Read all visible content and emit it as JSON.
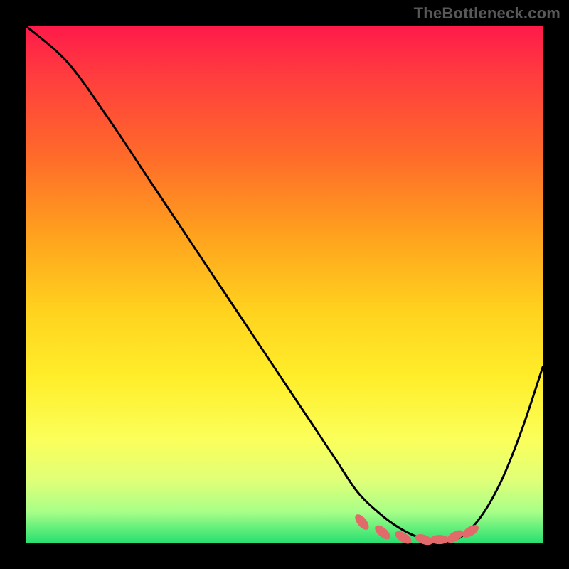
{
  "watermark": "TheBottleneck.com",
  "chart_data": {
    "type": "line",
    "title": "",
    "xlabel": "",
    "ylabel": "",
    "xlim": [
      0,
      100
    ],
    "ylim": [
      0,
      100
    ],
    "grid": false,
    "legend": false,
    "series": [
      {
        "name": "bottleneck-curve",
        "color": "#000000",
        "x": [
          0,
          8,
          16,
          24,
          32,
          40,
          48,
          56,
          60,
          64,
          68,
          72,
          76,
          80,
          84,
          88,
          92,
          96,
          100
        ],
        "y": [
          100,
          93,
          82,
          70,
          58,
          46,
          34,
          22,
          16,
          10,
          6,
          3,
          1,
          0,
          1,
          5,
          12,
          22,
          34
        ]
      }
    ],
    "markers": {
      "name": "highlight-dots",
      "color": "#e36a6a",
      "points": [
        {
          "x": 65,
          "y": 4.0
        },
        {
          "x": 69,
          "y": 2.0
        },
        {
          "x": 73,
          "y": 1.0
        },
        {
          "x": 77,
          "y": 0.6
        },
        {
          "x": 80,
          "y": 0.6
        },
        {
          "x": 83,
          "y": 1.2
        },
        {
          "x": 86,
          "y": 2.2
        }
      ]
    },
    "background_gradient": {
      "top": "#ff1a4a",
      "mid": "#ffee2a",
      "bottom": "#28e070"
    }
  }
}
